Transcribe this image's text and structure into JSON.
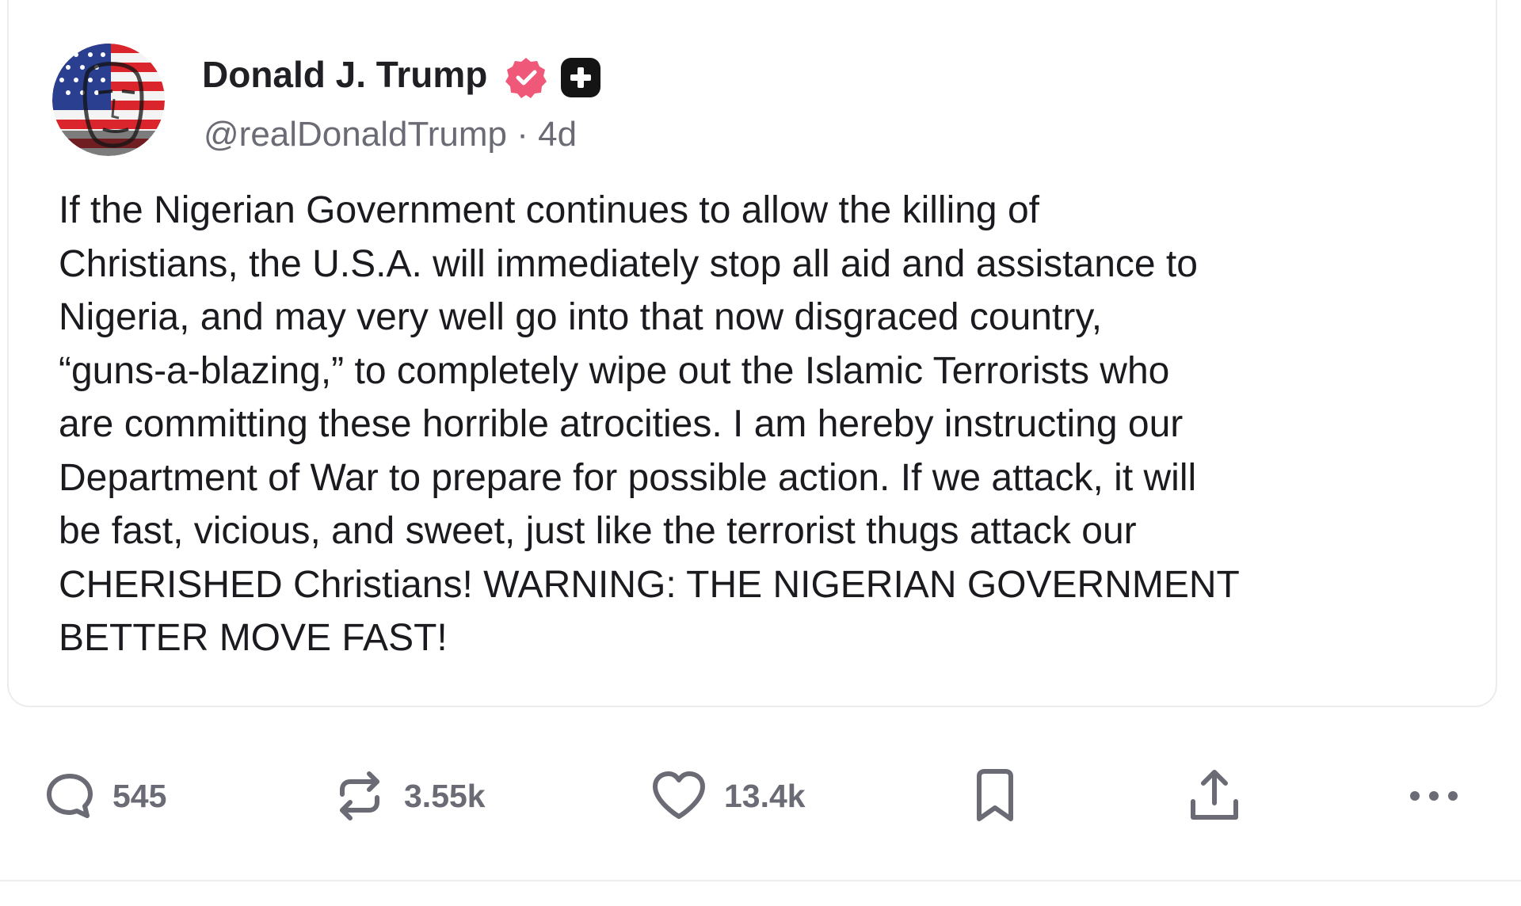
{
  "post": {
    "author": {
      "display_name": "Donald J. Trump",
      "handle": "@realDonaldTrump",
      "separator": "·",
      "time_ago": "4d",
      "verified_icon": "verified-badge-icon",
      "plus_icon": "plus-badge-icon"
    },
    "lines": [
      "If the Nigerian Government continues to allow the killing of",
      "Christians, the U.S.A. will immediately stop all aid and assistance to",
      "Nigeria, and may very well go into that now disgraced country,",
      "“guns-a-blazing,” to completely wipe out the Islamic Terrorists who",
      "are committing these horrible atrocities. I am hereby instructing our",
      "Department of War to prepare for possible action. If we attack, it will",
      "be fast, vicious, and sweet, just like the terrorist thugs attack our",
      "CHERISHED Christians! WARNING: THE NIGERIAN GOVERNMENT",
      "BETTER MOVE FAST!"
    ]
  },
  "actions": {
    "reply": {
      "icon": "reply-icon",
      "count": "545"
    },
    "repost": {
      "icon": "repost-icon",
      "count": "3.55k"
    },
    "like": {
      "icon": "heart-icon",
      "count": "13.4k"
    },
    "bookmark": {
      "icon": "bookmark-icon"
    },
    "share": {
      "icon": "share-icon"
    },
    "more": {
      "icon": "more-icon"
    }
  },
  "colors": {
    "verified": "#f0587a",
    "text": "#1a1a1f",
    "muted": "#6b6b75",
    "border": "#ececec"
  }
}
